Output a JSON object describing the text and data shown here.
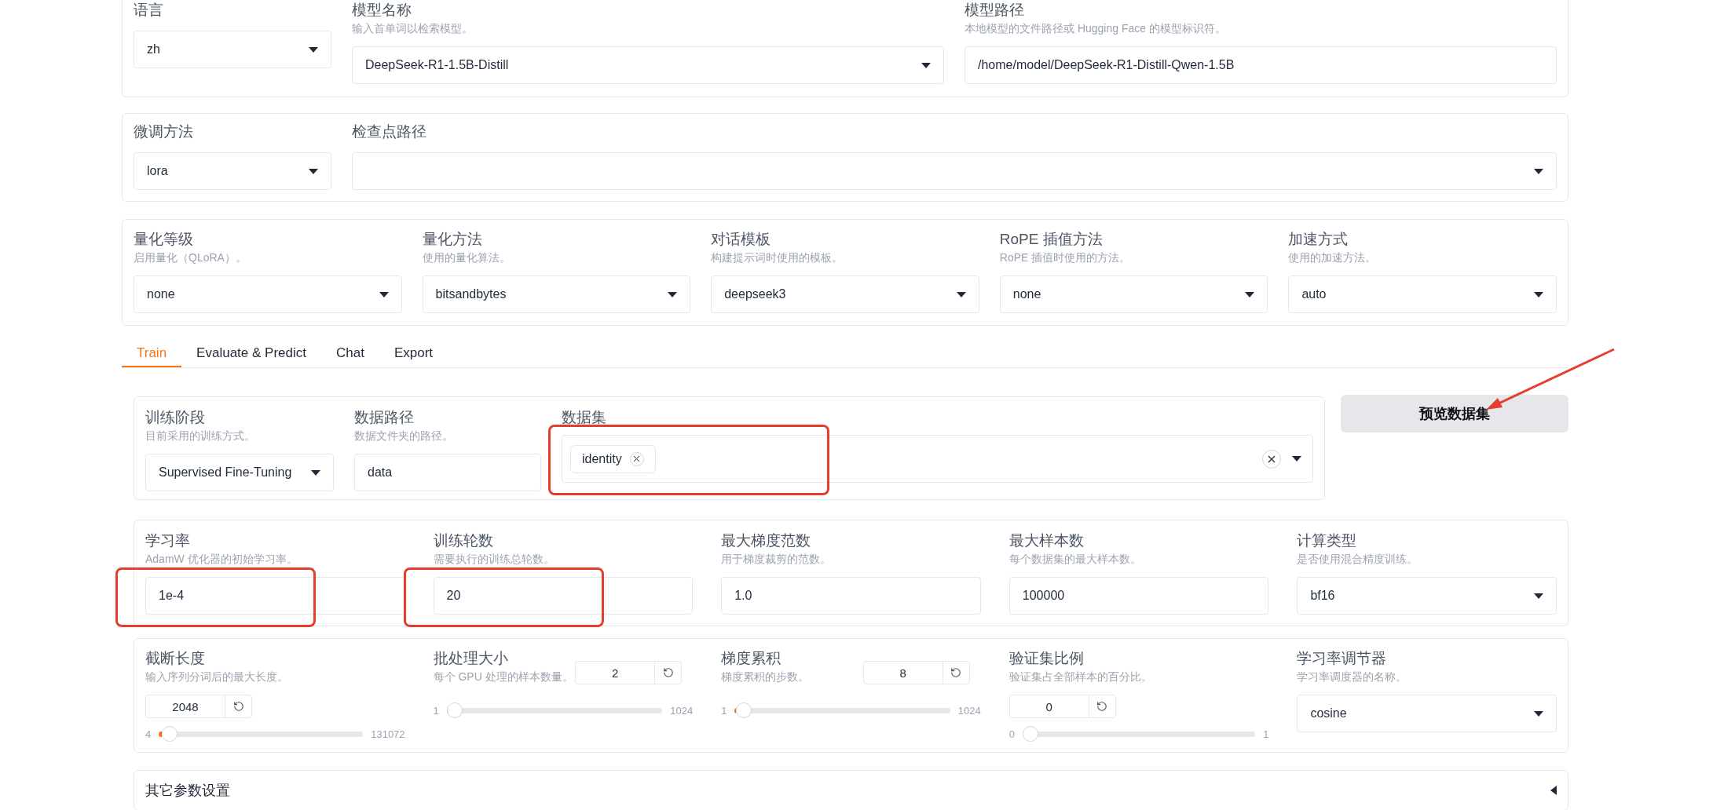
{
  "top_panels": [
    {
      "fields": [
        {
          "kind": "select",
          "label": "语言",
          "value": "zh",
          "fixed": true
        },
        {
          "kind": "select",
          "label": "模型名称",
          "hint": "输入首单词以检索模型。",
          "value": "DeepSeek-R1-1.5B-Distill"
        },
        {
          "kind": "input",
          "label": "模型路径",
          "hint": "本地模型的文件路径或 Hugging Face 的模型标识符。",
          "value": "/home/model/DeepSeek-R1-Distill-Qwen-1.5B"
        }
      ]
    },
    {
      "fields": [
        {
          "kind": "select",
          "label": "微调方法",
          "value": "lora",
          "fixed": true
        },
        {
          "kind": "select",
          "label": "检查点路径"
        }
      ]
    },
    {
      "fields": [
        {
          "kind": "select",
          "label": "量化等级",
          "hint": "启用量化（QLoRA）。",
          "value": "none"
        },
        {
          "kind": "select",
          "label": "量化方法",
          "hint": "使用的量化算法。",
          "value": "bitsandbytes"
        },
        {
          "kind": "select",
          "label": "对话模板",
          "hint": "构建提示词时使用的模板。",
          "value": "deepseek3"
        },
        {
          "kind": "select",
          "label": "RoPE 插值方法",
          "hint": "RoPE 插值时使用的方法。",
          "value": "none"
        },
        {
          "kind": "select",
          "label": "加速方式",
          "hint": "使用的加速方法。",
          "value": "auto"
        }
      ]
    }
  ],
  "tabs": [
    {
      "label": "Train",
      "selected": true
    },
    {
      "label": "Evaluate & Predict",
      "selected": false
    },
    {
      "label": "Chat",
      "selected": false
    },
    {
      "label": "Export",
      "selected": false
    }
  ],
  "train_panel": {
    "fields": [
      {
        "kind": "select",
        "label": "训练阶段",
        "hint": "目前采用的训练方式。",
        "value": "Supervised Fine-Tuning",
        "fixed": true
      },
      {
        "kind": "input",
        "label": "数据路径",
        "hint": "数据文件夹的路径。",
        "value": "data",
        "fixed": true
      },
      {
        "kind": "tags",
        "label": "数据集",
        "tags": [
          "identity"
        ],
        "highlighted": true
      }
    ]
  },
  "preview_button": "预览数据集",
  "param_panels": [
    {
      "fields": [
        {
          "kind": "input",
          "label": "学习率",
          "hint": "AdamW 优化器的初始学习率。",
          "value": "1e-4",
          "highlighted": true
        },
        {
          "kind": "input",
          "label": "训练轮数",
          "hint": "需要执行的训练总轮数。",
          "value": "20",
          "highlighted": true
        },
        {
          "kind": "input",
          "label": "最大梯度范数",
          "hint": "用于梯度裁剪的范数。",
          "value": "1.0"
        },
        {
          "kind": "input",
          "label": "最大样本数",
          "hint": "每个数据集的最大样本数。",
          "value": "100000"
        },
        {
          "kind": "select",
          "label": "计算类型",
          "hint": "是否使用混合精度训练。",
          "value": "bf16"
        }
      ]
    },
    {
      "fields": [
        {
          "kind": "slider",
          "label": "截断长度",
          "hint": "输入序列分词后的最大长度。",
          "value": "2048",
          "min": "4",
          "max": "131072",
          "level": 0.016,
          "below": true
        },
        {
          "kind": "slider",
          "label": "批处理大小",
          "hint": "每个 GPU 处理的样本数量。",
          "value": "2",
          "min": "1",
          "max": "1024",
          "level": 0.001
        },
        {
          "kind": "slider",
          "label": "梯度累积",
          "hint": "梯度累积的步数。",
          "value": "8",
          "min": "1",
          "max": "1024",
          "level": 0.007
        },
        {
          "kind": "slider",
          "label": "验证集比例",
          "hint": "验证集占全部样本的百分比。",
          "value": "0",
          "min": "0",
          "max": "1",
          "level": 0,
          "below": true
        },
        {
          "kind": "select",
          "label": "学习率调节器",
          "hint": "学习率调度器的名称。",
          "value": "cosine"
        }
      ]
    }
  ],
  "accordion": {
    "label": "其它参数设置",
    "expanded": false
  }
}
